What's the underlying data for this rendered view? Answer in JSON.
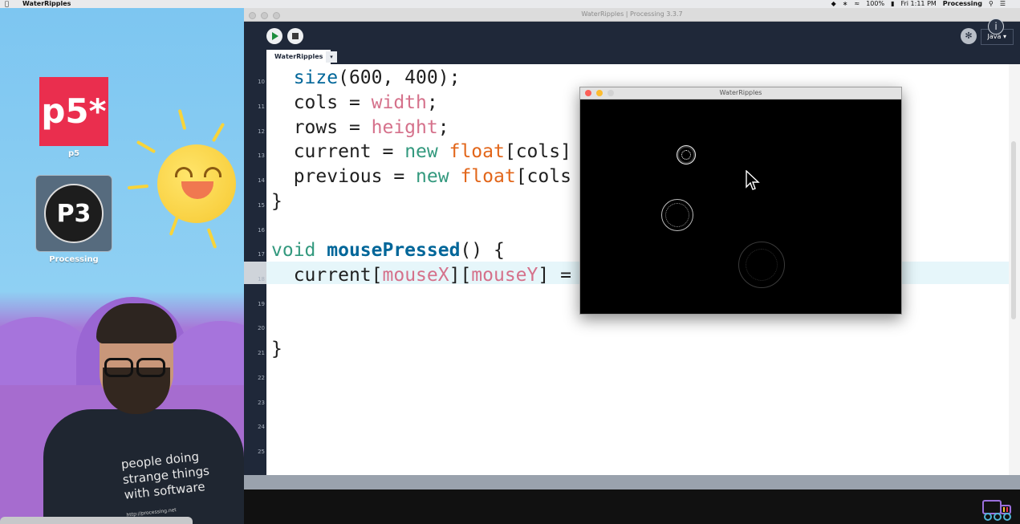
{
  "menubar": {
    "app_name": "WaterRipples",
    "battery": "100%",
    "clock": "Fri 1:11 PM",
    "active_app": "Processing"
  },
  "desktop": {
    "icons": [
      {
        "label": "p5",
        "glyph": "p5*"
      },
      {
        "label": "Processing",
        "glyph": "P3"
      }
    ],
    "shirt_lines": [
      "people doing",
      "strange things",
      "with software"
    ],
    "shirt_url": "http://processing.net"
  },
  "ide": {
    "window_title": "WaterRipples | Processing 3.3.7",
    "mode": "Java ▾",
    "tab_label": "WaterRipples",
    "tab_menu": "▾",
    "line_numbers": [
      "10",
      "11",
      "12",
      "13",
      "14",
      "15",
      "16",
      "17",
      "18",
      "19",
      "20",
      "21",
      "22",
      "23",
      "24",
      "25"
    ],
    "code": {
      "l10": {
        "fn": "size",
        "rest": "(600, 400);"
      },
      "l11": {
        "name": "cols",
        "op": " = ",
        "var": "width",
        "end": ";"
      },
      "l12": {
        "name": "rows",
        "op": " = ",
        "var": "height",
        "end": ";"
      },
      "l13": {
        "name": "current",
        "op": " = ",
        "kw": "new",
        "type": "float",
        "tail": "[cols]"
      },
      "l14": {
        "name": "previous",
        "op": " = ",
        "kw": "new",
        "type": "float",
        "tail": "[cols"
      },
      "l15": "}",
      "l17": {
        "kw": "void",
        "fn": "mousePressed",
        "rest": "() {"
      },
      "l18": {
        "name": "current",
        "b1": "[",
        "v1": "mouseX",
        "b2": "][",
        "v2": "mouseY",
        "b3": "]",
        "tail": " = "
      },
      "l21": "}"
    }
  },
  "sketch": {
    "title": "WaterRipples"
  },
  "colors": {
    "ide_background": "#1f2839",
    "keyword_fn": "#006699",
    "keyword_var": "#d5718b",
    "keyword_type": "#e2661a",
    "keyword_new": "#33997e"
  },
  "icons": [
    "apple-icon",
    "dropbox-icon",
    "wifi-icon",
    "bluetooth-icon",
    "battery-icon",
    "search-icon",
    "menu-list-icon",
    "play-icon",
    "stop-icon",
    "debug-icon",
    "info-icon",
    "mouse-cursor-icon"
  ]
}
